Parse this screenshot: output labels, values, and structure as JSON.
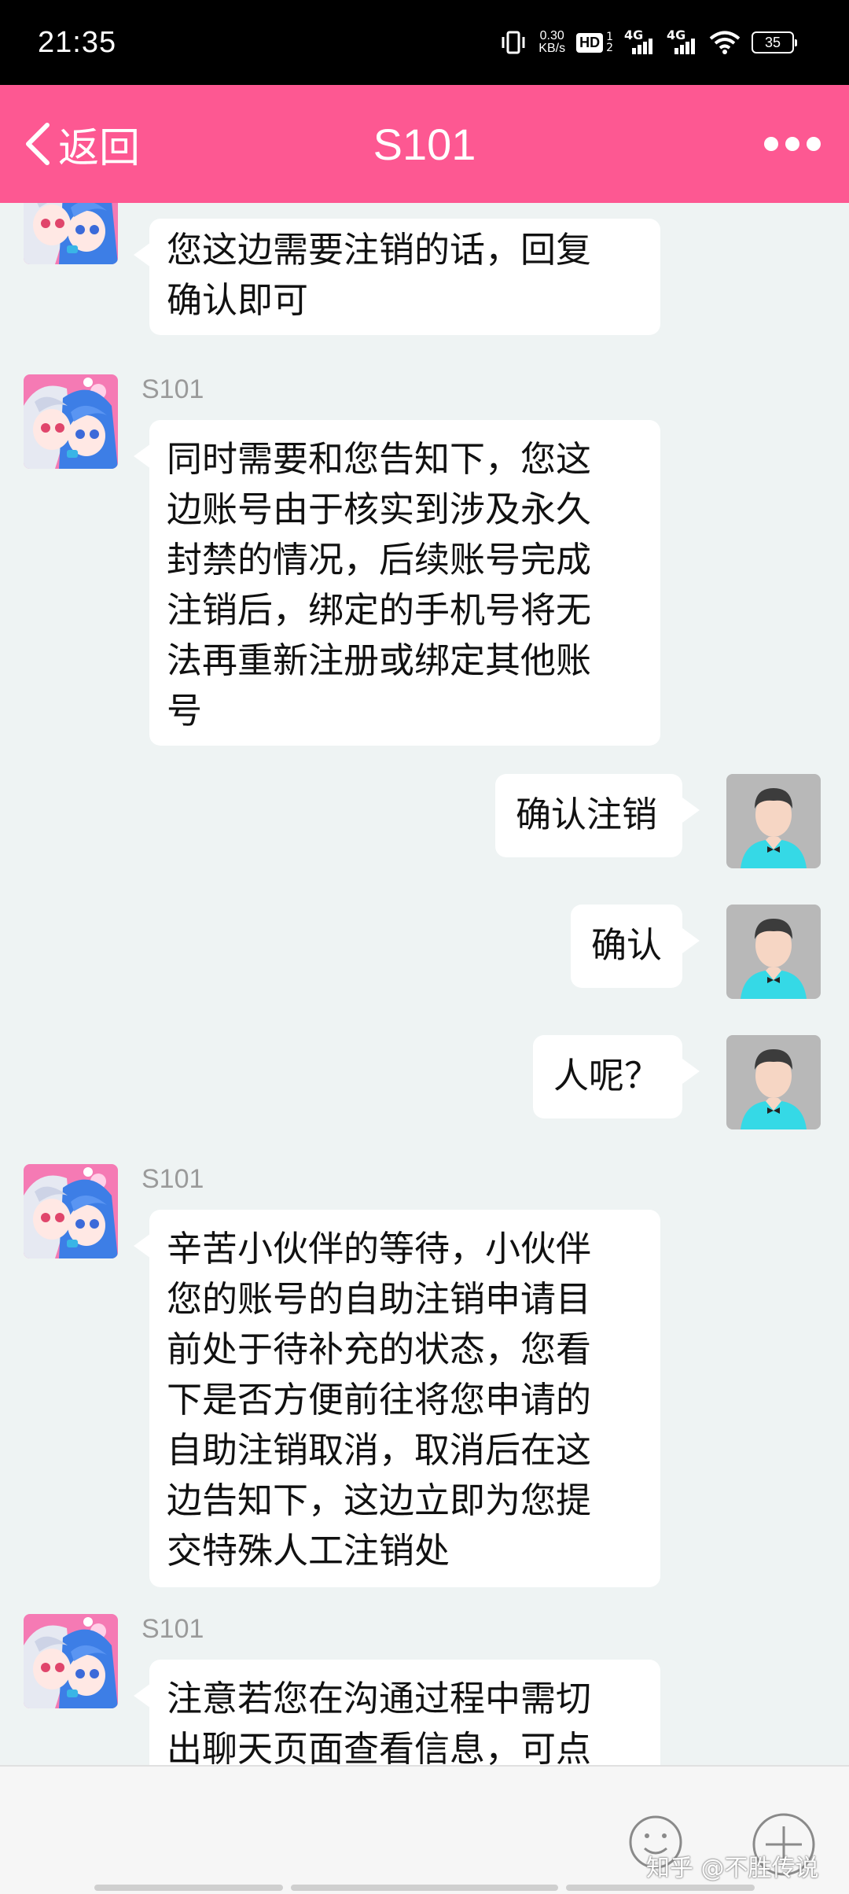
{
  "status_bar": {
    "time": "21:35",
    "speed_value": "0.30",
    "speed_unit": "KB/s",
    "hd_label": "HD",
    "hd_sup_top": "1",
    "hd_sup_bottom": "2",
    "signal1_label": "4G",
    "signal2_label": "4G",
    "battery": "35"
  },
  "header": {
    "back_label": "返回",
    "title": "S101",
    "background": "#fd5892"
  },
  "messages": [
    {
      "side": "left",
      "sender": "",
      "lines": [
        "您这边需要注销的话，回复",
        "确认即可"
      ]
    },
    {
      "side": "left",
      "sender": "S101",
      "lines": [
        "同时需要和您告知下，您这",
        "边账号由于核实到涉及永久",
        "封禁的情况，后续账号完成",
        "注销后，绑定的手机号将无",
        "法再重新注册或绑定其他账",
        "号"
      ]
    },
    {
      "side": "right",
      "lines": [
        "确认注销"
      ]
    },
    {
      "side": "right",
      "lines": [
        "确认"
      ]
    },
    {
      "side": "right",
      "lines": [
        "人呢？"
      ]
    },
    {
      "side": "left",
      "sender": "S101",
      "lines": [
        "辛苦小伙伴的等待，小伙伴",
        "您的账号的自助注销申请目",
        "前处于待补充的状态，您看",
        "下是否方便前往将您申请的",
        "自助注销取消，取消后在这",
        "边告知下，这边立即为您提",
        "交特殊人工注销处"
      ]
    },
    {
      "side": "left",
      "sender": "S101",
      "lines": [
        "注意若您在沟通过程中需切",
        "出聊天页面查看信息，可点"
      ]
    }
  ],
  "input_bar": {
    "watermark": "知乎 @不胜传说"
  },
  "icons": {
    "back": "chevron-left-icon",
    "more": "more-dots-icon",
    "emoji": "smiley-icon",
    "plus": "plus-circle-icon"
  }
}
